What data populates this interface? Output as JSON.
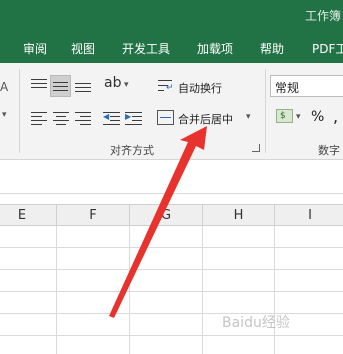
{
  "window": {
    "title": "工作簿"
  },
  "tabs": [
    "审阅",
    "视图",
    "开发工具",
    "加载项",
    "帮助",
    "PDF工"
  ],
  "ribbon": {
    "alignment": {
      "wrap_text_label": "自动换行",
      "merge_center_label": "合并后居中",
      "group_label": "对齐方式"
    },
    "number": {
      "format_value": "常规",
      "percent_symbol": "%",
      "comma_symbol": ",",
      "group_label": "数字"
    }
  },
  "columns": [
    "E",
    "F",
    "G",
    "H",
    "I"
  ],
  "annotation": {
    "arrow_color": "#e8322d"
  },
  "watermark": "Baidu经验"
}
